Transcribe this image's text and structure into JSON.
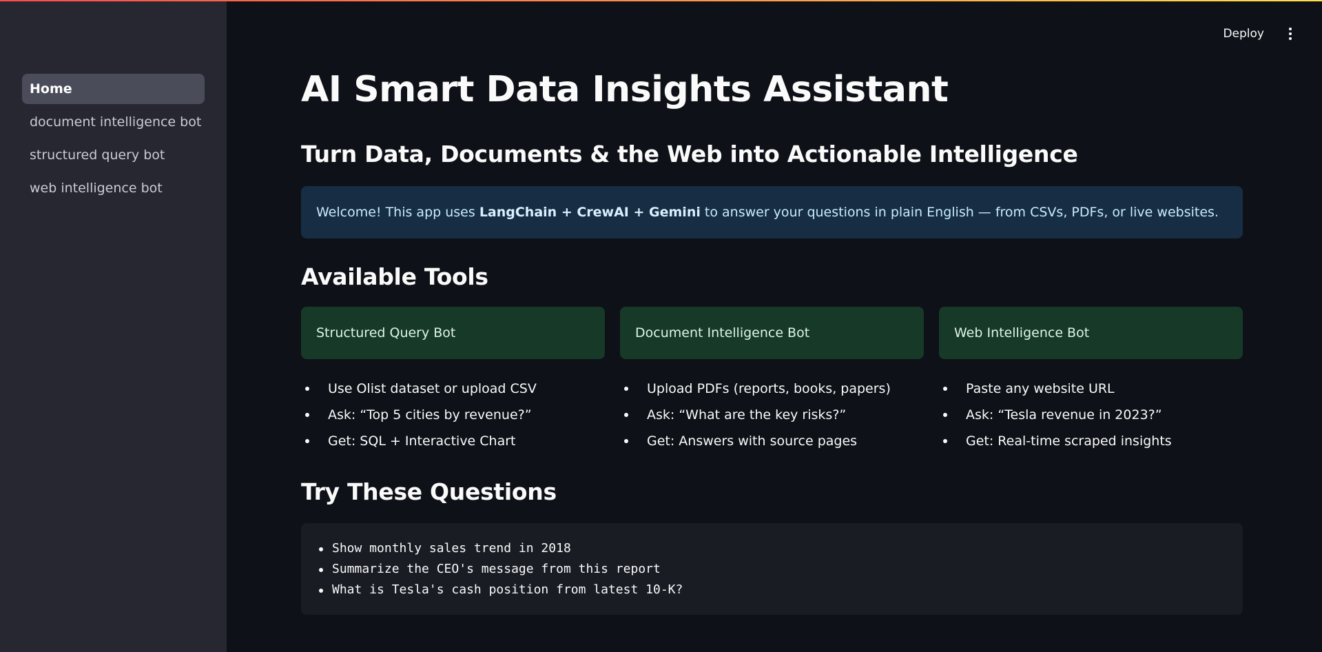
{
  "sidebar": {
    "items": [
      {
        "label": "Home",
        "active": true
      },
      {
        "label": "document intelligence bot",
        "active": false
      },
      {
        "label": "structured query bot",
        "active": false
      },
      {
        "label": "web intelligence bot",
        "active": false
      }
    ]
  },
  "header": {
    "deploy_label": "Deploy",
    "menu_icon": "kebab-menu-icon"
  },
  "main": {
    "title": "AI Smart Data Insights Assistant",
    "subtitle": "Turn Data, Documents & the Web into Actionable Intelligence",
    "info": {
      "prefix": "Welcome! This app uses ",
      "highlight": "LangChain + CrewAI + Gemini",
      "suffix": " to answer your questions in plain English — from CSVs, PDFs, or live websites."
    },
    "tools_heading": "Available Tools",
    "tools": [
      {
        "name": "Structured Query Bot",
        "points": [
          "Use Olist dataset or upload CSV",
          "Ask: “Top 5 cities by revenue?”",
          "Get: SQL + Interactive Chart"
        ]
      },
      {
        "name": "Document Intelligence Bot",
        "points": [
          "Upload PDFs (reports, books, papers)",
          "Ask: “What are the key risks?”",
          "Get: Answers with source pages"
        ]
      },
      {
        "name": "Web Intelligence Bot",
        "points": [
          "Paste any website URL",
          "Ask: “Tesla revenue in 2023?”",
          "Get: Real-time scraped insights"
        ]
      }
    ],
    "questions_heading": "Try These Questions",
    "questions": [
      "Show monthly sales trend in 2018",
      "Summarize the CEO's message from this report",
      "What is Tesla's cash position from latest 10-K?"
    ]
  },
  "colors": {
    "background": "#0e1117",
    "sidebar": "#262730",
    "info_bg": "#172d43",
    "tool_card_bg": "#173928",
    "code_bg": "#1a1c24"
  }
}
